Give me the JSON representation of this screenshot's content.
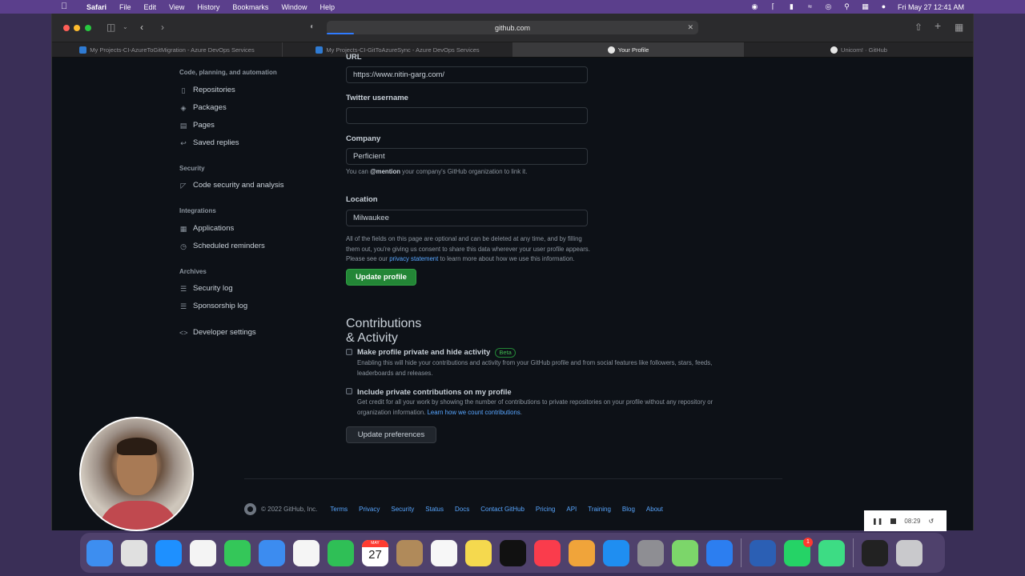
{
  "menubar": {
    "app": "Safari",
    "items": [
      "File",
      "Edit",
      "View",
      "History",
      "Bookmarks",
      "Window",
      "Help"
    ],
    "clock": "Fri May 27  12:41 AM"
  },
  "browser": {
    "url": "github.com",
    "tabs": [
      {
        "label": "My Projects-CI-AzureToGitMigration - Azure DevOps Services",
        "icon": "azure-devops-icon",
        "active": false
      },
      {
        "label": "My Projects-CI-GitToAzureSync - Azure DevOps Services",
        "icon": "azure-devops-icon",
        "active": false
      },
      {
        "label": "Your Profile",
        "icon": "github-icon",
        "active": true
      },
      {
        "label": "Unicorn! · GitHub",
        "icon": "github-icon",
        "active": false
      }
    ]
  },
  "sidebar": {
    "sections": [
      {
        "heading": "Code, planning, and automation",
        "items": [
          {
            "label": "Repositories",
            "icon": "repo-icon"
          },
          {
            "label": "Packages",
            "icon": "package-icon"
          },
          {
            "label": "Pages",
            "icon": "browser-icon"
          },
          {
            "label": "Saved replies",
            "icon": "reply-icon"
          }
        ]
      },
      {
        "heading": "Security",
        "items": [
          {
            "label": "Code security and analysis",
            "icon": "shield-icon"
          }
        ]
      },
      {
        "heading": "Integrations",
        "items": [
          {
            "label": "Applications",
            "icon": "apps-icon"
          },
          {
            "label": "Scheduled reminders",
            "icon": "clock-icon"
          }
        ]
      },
      {
        "heading": "Archives",
        "items": [
          {
            "label": "Security log",
            "icon": "log-icon"
          },
          {
            "label": "Sponsorship log",
            "icon": "log-icon"
          }
        ]
      }
    ],
    "developer_settings": "Developer settings"
  },
  "form": {
    "url_label": "URL",
    "url_value": "https://www.nitin-garg.com/",
    "twitter_label": "Twitter username",
    "twitter_value": "",
    "company_label": "Company",
    "company_value": "Perficient",
    "company_note_pre": "You can ",
    "company_note_mention": "@mention",
    "company_note_post": " your company's GitHub organization to link it.",
    "location_label": "Location",
    "location_value": "Milwaukee",
    "consent_line1": "All of the fields on this page are optional and can be deleted at any time, and by filling",
    "consent_line2": "them out, you're giving us consent to share this data wherever your user profile appears.",
    "consent_line3_pre": "Please see our ",
    "consent_link": "privacy statement",
    "consent_line3_post": " to learn more about how we use this information.",
    "update_button": "Update profile"
  },
  "contributions": {
    "title": "Contributions & Activity",
    "private_label": "Make profile private and hide activity",
    "beta": "Beta",
    "private_desc1": "Enabling this will hide your contributions and activity from your GitHub profile and from social features like followers, stars, feeds,",
    "private_desc2": "leaderboards and releases.",
    "include_label": "Include private contributions on my profile",
    "include_desc1": "Get credit for all your work by showing the number of contributions to private repositories on your profile without any repository or",
    "include_desc2_pre": "organization information. ",
    "include_link": "Learn how we count contributions",
    "include_desc2_post": ".",
    "button": "Update preferences"
  },
  "footer": {
    "copyright": "© 2022 GitHub, Inc.",
    "links": [
      "Terms",
      "Privacy",
      "Security",
      "Status",
      "Docs",
      "Contact GitHub",
      "Pricing",
      "API",
      "Training",
      "Blog",
      "About"
    ]
  },
  "recorder": {
    "time": "08:29"
  },
  "dock": {
    "calendar_month": "MAY",
    "calendar_day": "27",
    "whatsapp_badge": "1",
    "apps": [
      {
        "name": "finder-icon",
        "color": "#3d8ef0"
      },
      {
        "name": "launchpad-icon",
        "color": "#e0e0e0"
      },
      {
        "name": "safari-icon",
        "color": "#1e90ff"
      },
      {
        "name": "chrome-icon",
        "color": "#f4f4f4"
      },
      {
        "name": "messages-icon",
        "color": "#34c759"
      },
      {
        "name": "mail-icon",
        "color": "#3c8cf0"
      },
      {
        "name": "photos-icon",
        "color": "#f5f5f5"
      },
      {
        "name": "facetime-icon",
        "color": "#2fbf56"
      },
      {
        "name": "calendar-icon",
        "color": "#ffffff"
      },
      {
        "name": "contacts-icon",
        "color": "#b08a5a"
      },
      {
        "name": "reminders-icon",
        "color": "#f7f7f7"
      },
      {
        "name": "notes-icon",
        "color": "#f5d94e"
      },
      {
        "name": "apple-tv-icon",
        "color": "#111111"
      },
      {
        "name": "music-icon",
        "color": "#fa3c4c"
      },
      {
        "name": "pages-icon",
        "color": "#f0a43a"
      },
      {
        "name": "app-store-icon",
        "color": "#1f8ef1"
      },
      {
        "name": "system-preferences-icon",
        "color": "#8e8e93"
      },
      {
        "name": "cloud-icon",
        "color": "#7cd66a"
      },
      {
        "name": "xcode-icon",
        "color": "#2c7ef0"
      },
      {
        "name": "word-icon",
        "color": "#2b5fb4"
      },
      {
        "name": "whatsapp-icon",
        "color": "#25d366"
      },
      {
        "name": "android-icon",
        "color": "#3ddc84"
      },
      {
        "name": "activity-monitor-icon",
        "color": "#222222"
      },
      {
        "name": "trash-icon",
        "color": "#c9c9cc"
      }
    ]
  }
}
